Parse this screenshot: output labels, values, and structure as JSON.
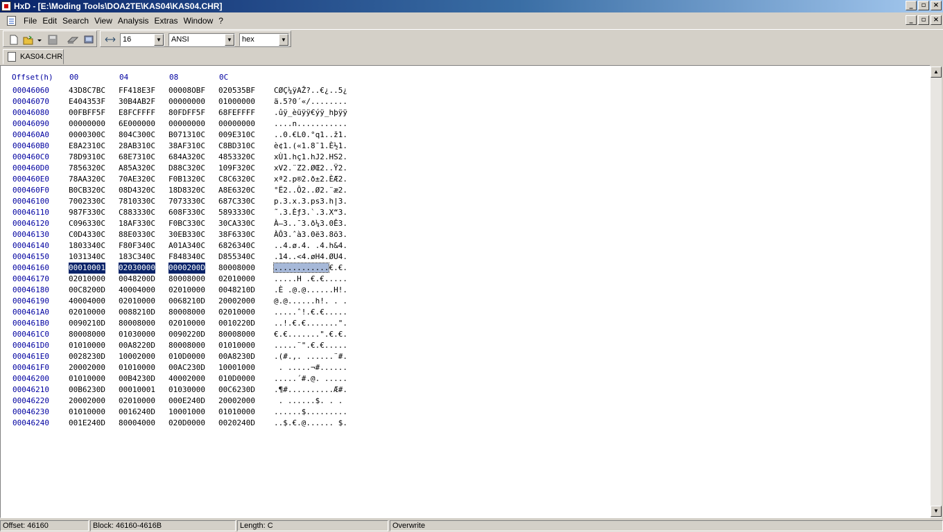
{
  "window": {
    "title": "HxD - [E:\\Moding Tools\\DOA2TE\\KAS04\\KAS04.CHR]"
  },
  "menu": {
    "items": [
      "File",
      "Edit",
      "Search",
      "View",
      "Analysis",
      "Extras",
      "Window",
      "?"
    ]
  },
  "toolbar": {
    "bytes_per_row": "16",
    "charset": "ANSI",
    "offset_base": "hex"
  },
  "tab": {
    "label": "KAS04.CHR"
  },
  "editor": {
    "offset_header": "Offset(h)",
    "column_headers": [
      "00",
      "04",
      "08",
      "0C"
    ],
    "selected_row_index": 16,
    "selected_groups": 3,
    "rows": [
      {
        "offset": "00046060",
        "groups": [
          "43D8C7BC",
          "FF418E3F",
          "00008OBF",
          "020535BF"
        ],
        "text": "CØÇ¼ÿAŽ?..€¿..5¿"
      },
      {
        "offset": "00046070",
        "groups": [
          "E404353F",
          "30B4AB2F",
          "00000000",
          "01000000"
        ],
        "text": "ä.5?0´«/........"
      },
      {
        "offset": "00046080",
        "groups": [
          "00FBFF5F",
          "E8FCFFFF",
          "80FDFF5F",
          "68FEFFFF"
        ],
        "text": ".ûÿ_èüÿÿ€ýÿ_hþÿÿ"
      },
      {
        "offset": "00046090",
        "groups": [
          "00000000",
          "6E000000",
          "00000000",
          "00000000"
        ],
        "text": "....n..........."
      },
      {
        "offset": "000460A0",
        "groups": [
          "0000300C",
          "804C300C",
          "B071310C",
          "009E310C"
        ],
        "text": "..0.€L0.°q1..ž1."
      },
      {
        "offset": "000460B0",
        "groups": [
          "E8A2310C",
          "28AB310C",
          "38AF310C",
          "C8BD310C"
        ],
        "text": "è¢1.(«1.8¯1.È½1."
      },
      {
        "offset": "000460C0",
        "groups": [
          "78D9310C",
          "68E7310C",
          "684A320C",
          "4853320C"
        ],
        "text": "xÙ1.hç1.hJ2.HS2."
      },
      {
        "offset": "000460D0",
        "groups": [
          "7856320C",
          "A85A320C",
          "D88C320C",
          "109F320C"
        ],
        "text": "xV2.¨Z2.ØŒ2..Ÿ2."
      },
      {
        "offset": "000460E0",
        "groups": [
          "78AA320C",
          "70AE320C",
          "F0B1320C",
          "C8C6320C"
        ],
        "text": "xª2.p®2.ð±2.ÈÆ2."
      },
      {
        "offset": "000460F0",
        "groups": [
          "B0CB320C",
          "08D4320C",
          "18D8320C",
          "A8E6320C"
        ],
        "text": "°Ë2..Ô2..Ø2.¨æ2."
      },
      {
        "offset": "00046100",
        "groups": [
          "7002330C",
          "7810330C",
          "7073330C",
          "687C330C"
        ],
        "text": "p.3.x.3.ps3.h|3."
      },
      {
        "offset": "00046110",
        "groups": [
          "987F330C",
          "C883330C",
          "608F330C",
          "5893330C"
        ],
        "text": "˜.3.Èƒ3.`.3.X“3."
      },
      {
        "offset": "00046120",
        "groups": [
          "C096330C",
          "18AF330C",
          "F0BC330C",
          "30CA330C"
        ],
        "text": "À–3..¯3.ð¼3.0Ê3."
      },
      {
        "offset": "00046130",
        "groups": [
          "C0D4330C",
          "88E0330C",
          "30EB330C",
          "38F6330C"
        ],
        "text": "ÀÔ3.ˆà3.0ë3.8ö3."
      },
      {
        "offset": "00046140",
        "groups": [
          "1803340C",
          "F80F340C",
          "A01A340C",
          "6826340C"
        ],
        "text": "..4.ø.4. .4.h&4."
      },
      {
        "offset": "00046150",
        "groups": [
          "1031340C",
          "183C340C",
          "F848340C",
          "D855340C"
        ],
        "text": ".14..<4.øH4.ØU4."
      },
      {
        "offset": "00046160",
        "groups": [
          "00010001",
          "02030000",
          "0000200D",
          "80008000"
        ],
        "text": "............€.€."
      },
      {
        "offset": "00046170",
        "groups": [
          "02010000",
          "0048200D",
          "80008000",
          "02010000"
        ],
        "text": ".....H .€.€....."
      },
      {
        "offset": "00046180",
        "groups": [
          "00C8200D",
          "40004000",
          "02010000",
          "0048210D"
        ],
        "text": ".È .@.@......H!."
      },
      {
        "offset": "00046190",
        "groups": [
          "40004000",
          "02010000",
          "0068210D",
          "20002000"
        ],
        "text": "@.@......h!. . ."
      },
      {
        "offset": "000461A0",
        "groups": [
          "02010000",
          "0088210D",
          "80008000",
          "02010000"
        ],
        "text": ".....ˆ!.€.€....."
      },
      {
        "offset": "000461B0",
        "groups": [
          "0090210D",
          "80008000",
          "02010000",
          "0010220D"
        ],
        "text": "..!.€.€.......\"."
      },
      {
        "offset": "000461C0",
        "groups": [
          "80008000",
          "01030000",
          "0090220D",
          "80008000"
        ],
        "text": "€.€.......\".€.€."
      },
      {
        "offset": "000461D0",
        "groups": [
          "01010000",
          "00A8220D",
          "80008000",
          "01010000"
        ],
        "text": ".....¨\".€.€....."
      },
      {
        "offset": "000461E0",
        "groups": [
          "0028230D",
          "10002000",
          "010D0000",
          "00A8230D"
        ],
        "text": ".(#.,. ......¨#."
      },
      {
        "offset": "000461F0",
        "groups": [
          "20002000",
          "01010000",
          "00AC230D",
          "10001000"
        ],
        "text": " . .....¬#......"
      },
      {
        "offset": "00046200",
        "groups": [
          "01010000",
          "00B4230D",
          "40002000",
          "010D0000"
        ],
        "text": ".....´#.@. ....."
      },
      {
        "offset": "00046210",
        "groups": [
          "00B6230D",
          "00010001",
          "01030000",
          "00C6230D"
        ],
        "text": ".¶#..........Æ#."
      },
      {
        "offset": "00046220",
        "groups": [
          "20002000",
          "02010000",
          "000E240D",
          "20002000"
        ],
        "text": " . ......$. . . "
      },
      {
        "offset": "00046230",
        "groups": [
          "01010000",
          "0016240D",
          "10001000",
          "01010000"
        ],
        "text": "......$........."
      },
      {
        "offset": "00046240",
        "groups": [
          "001E240D",
          "80004000",
          "020D0000",
          "0020240D"
        ],
        "text": "..$.€.@...... $."
      }
    ]
  },
  "status": {
    "offset": "Offset: 46160",
    "block": "Block: 46160-4616B",
    "length": "Length: C",
    "mode": "Overwrite"
  },
  "icons": [
    "app-icon",
    "new-file-icon",
    "open-file-icon",
    "save-icon",
    "disk-editor-icon",
    "ram-editor-icon",
    "bytes-per-row-icon",
    "document-icon"
  ]
}
